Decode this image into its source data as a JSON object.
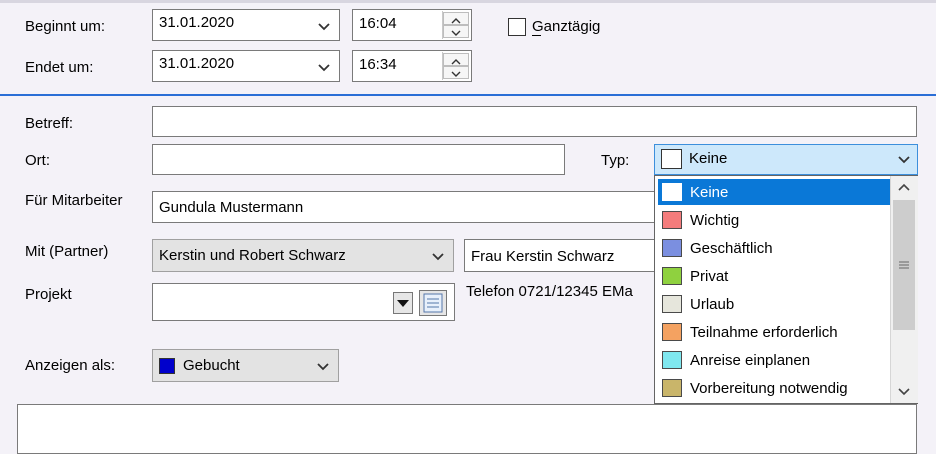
{
  "labels": {
    "start": "Beginnt um:",
    "end": "Endet um:",
    "subject": "Betreff:",
    "location": "Ort:",
    "type": "Typ:",
    "employee": "Für Mitarbeiter",
    "partner": "Mit (Partner)",
    "project": "Projekt",
    "show_as": "Anzeigen als:"
  },
  "start": {
    "date": "31.01.2020",
    "time": "16:04"
  },
  "end": {
    "date": "31.01.2020",
    "time": "16:34"
  },
  "all_day": {
    "label": "Ganztägig",
    "checked": false
  },
  "subject_value": "",
  "location_value": "",
  "type_select": {
    "value": "Keine",
    "swatch": "#ffffff"
  },
  "employee_value": "Gundula Mustermann",
  "partner": {
    "company": "Kerstin und Robert Schwarz",
    "contact": "Frau Kerstin Schwarz",
    "phone_text": "Telefon 0721/12345  EMa"
  },
  "project_value": "",
  "show_as": {
    "value": "Gebucht",
    "swatch": "#0000cc"
  },
  "notes_value": "",
  "type_options": [
    {
      "label": "Keine",
      "color": "#ffffff",
      "selected": true
    },
    {
      "label": "Wichtig",
      "color": "#f47c7c"
    },
    {
      "label": "Geschäftlich",
      "color": "#7b8fe0"
    },
    {
      "label": "Privat",
      "color": "#8fd13f"
    },
    {
      "label": "Urlaub",
      "color": "#e6e6dc"
    },
    {
      "label": "Teilnahme erforderlich",
      "color": "#f4a261"
    },
    {
      "label": "Anreise einplanen",
      "color": "#7fe8f0"
    },
    {
      "label": "Vorbereitung notwendig",
      "color": "#c9b56a"
    }
  ]
}
